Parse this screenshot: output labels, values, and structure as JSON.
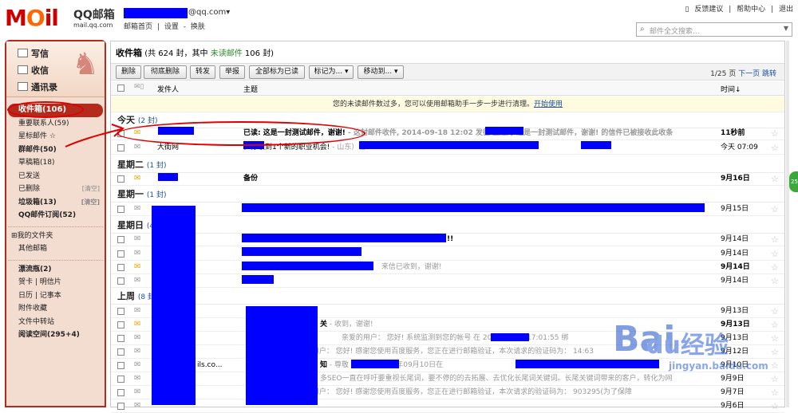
{
  "header": {
    "logo": "M",
    "logo_o": "O",
    "logo_rest": "il",
    "brand": "QQ邮箱",
    "brand_sub": "mail.qq.com",
    "account_domain": "@qq.com▾",
    "links": [
      "邮箱首页",
      "|",
      "设置",
      "-",
      "换肤"
    ],
    "top_right": [
      "反馈建议",
      "|",
      "帮助中心",
      "|",
      "退出"
    ],
    "search_placeholder": "邮件全文搜索..."
  },
  "sidebar": {
    "compose": "写信",
    "inbox_quick": "收信",
    "contacts": "通讯录",
    "folders": [
      {
        "label": "收件箱(106)",
        "selected": true
      },
      {
        "label": "重要联系人(59)"
      },
      {
        "label": "星标邮件 ☆"
      },
      {
        "label": "群邮件(50)",
        "bold": true
      },
      {
        "label": "草稿箱(18)"
      },
      {
        "label": "已发送"
      },
      {
        "label": "已删除",
        "action": "[清空]"
      },
      {
        "label": "垃圾箱(13)",
        "action": "[清空]",
        "bold": true
      },
      {
        "label": "QQ邮件订阅(52)",
        "bold": true
      },
      {
        "label": "⊞我的文件夹"
      },
      {
        "label": "其他邮箱"
      },
      {
        "label": "漂流瓶(2)",
        "bold": true
      },
      {
        "label": "贺卡 | 明信片"
      },
      {
        "label": "日历 | 记事本"
      },
      {
        "label": "附件收藏"
      },
      {
        "label": "文件中转站"
      },
      {
        "label": "阅读空间(295+4)",
        "bold": true
      }
    ]
  },
  "mailbox": {
    "title": "收件箱",
    "summary": "(共 624 封，其中",
    "unread_label": "未读邮件",
    "unread_count": "106 封)"
  },
  "toolbar": {
    "buttons": [
      "删除",
      "彻底删除",
      "转发",
      "举报",
      "全部标为已读",
      "标记为... ▾",
      "移动到... ▾"
    ],
    "pager": "1/25 页",
    "next": "下一页",
    "jump": "跳转"
  },
  "columns": {
    "sender": "发件人",
    "subject": "主题",
    "time": "时间↓"
  },
  "notice": {
    "text": "您的未读邮件数过多，您可以使用邮箱助手一步一步进行清理。",
    "link": "开始使用"
  },
  "groups": [
    {
      "title": "今天",
      "count": "(2 封)"
    },
    {
      "title": "星期二",
      "count": "(1 封)"
    },
    {
      "title": "星期一",
      "count": "(1 封)"
    },
    {
      "title": "星期日",
      "count": "(4"
    },
    {
      "title": "上周",
      "count": "(8 封"
    }
  ],
  "rows": [
    {
      "sender": "",
      "subject": "已读: 这是一封测试邮件，谢谢!",
      "preview": " - 这封邮件收件, 2014-09-18 12:02 发往          主题为 这是一封测试邮件，谢谢! 的信件已被接收此收条",
      "date": "11秒前",
      "bold": true,
      "unread": true
    },
    {
      "sender": "大街网",
      "subject": "，你收到1个新的职业机会!",
      "preview": " -                                        山东）信",
      "date": "今天 07:09"
    },
    {
      "sender": "",
      "subject": "备份",
      "preview": "",
      "date": "9月16日",
      "bold": true,
      "unread": true
    },
    {
      "sender": "",
      "subject": "",
      "preview": "",
      "date": "9月15日"
    },
    {
      "sender": "",
      "subject": "!!",
      "preview": "",
      "date": "9月14日"
    },
    {
      "sender": "",
      "subject": "",
      "preview": "",
      "date": "9月14日"
    },
    {
      "sender": "",
      "subject": "",
      "preview": " 来信已收到，谢谢!",
      "date": "9月14日",
      "bold": true,
      "unread": true
    },
    {
      "sender": "",
      "subject": "",
      "preview": "",
      "date": "9月14日"
    },
    {
      "sender": "",
      "subject": "",
      "preview": "",
      "date": "9月13日"
    },
    {
      "sender": "",
      "subject": "关",
      "preview": " - 收到，谢谢!",
      "date": "9月13日",
      "bold": true,
      "unread": true
    },
    {
      "sender": "",
      "subject": "",
      "preview": "      亲爱的用户：   您好! 系统监测到您的帐号          在 2014-09-13 17:01:55 绑",
      "date": "9月13日"
    },
    {
      "sender": "",
      "subject": "",
      "preview": "      亲爱的用户：   您好! 感谢您使用百度服务，您正在进行邮箱验证，本次请求的验证码为： 14:63",
      "date": "9月12日"
    },
    {
      "sender": "ils.co...",
      "subject": "知",
      "preview": " - 尊敬          您好! 于2014年09月10日在",
      "date": "9月10日"
    },
    {
      "sender": "",
      "subject": "",
      "preview": "多SEO一直在呼吁要重视长尾词，要不停的的去拓展、去优化长尾词关键词。长尾关键词带来的客户，转化为网",
      "date": "9月9日"
    },
    {
      "sender": "",
      "subject": "",
      "preview": "      亲爱的用户：   您好! 感谢您使用百度服务，您正在进行邮箱验证，本次请求的验证码为： 903295(为了保障",
      "date": "9月7日"
    },
    {
      "sender": "",
      "subject": "",
      "preview": "",
      "date": "9月6日"
    }
  ],
  "side_tab": "25",
  "watermark": {
    "logo": "Bai",
    "logo_end": "du",
    "text": "经验",
    "url": "jingyan.baidu.com"
  },
  "colors": {
    "brand_red": "#b42b1e",
    "redact_blue": "#0000ff",
    "link_blue": "#1b4fa0",
    "unread_green": "#2a8a2a"
  }
}
